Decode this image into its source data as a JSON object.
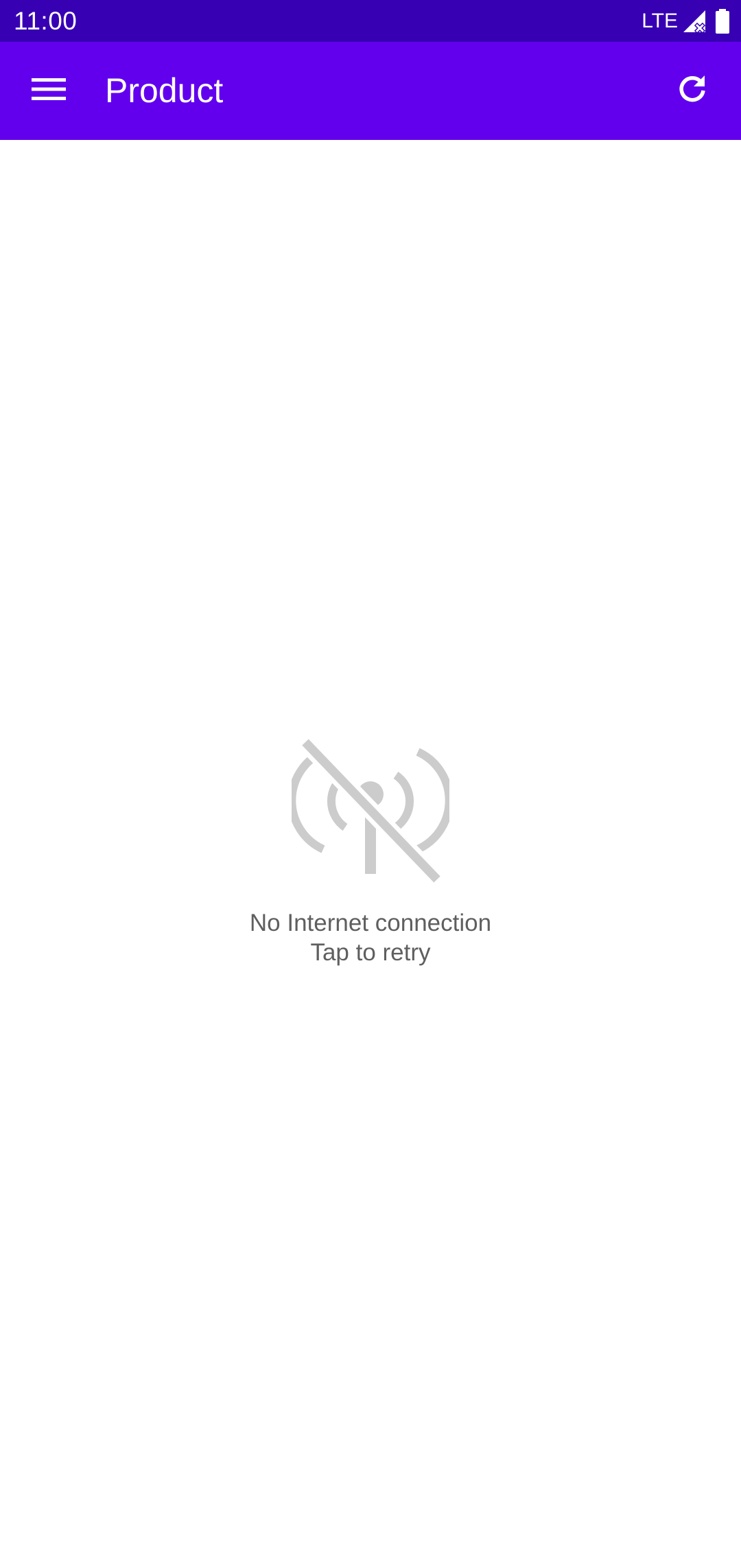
{
  "status_bar": {
    "time": "11:00",
    "network": "LTE",
    "icons": [
      "signal-no-service-icon",
      "battery-full-icon"
    ]
  },
  "app_bar": {
    "title": "Product",
    "menu_icon": "menu-icon",
    "refresh_icon": "refresh-icon"
  },
  "empty_state": {
    "icon": "no-signal-icon",
    "message": "No Internet connection",
    "action": "Tap to retry"
  },
  "colors": {
    "status_bar": "#3700b3",
    "app_bar": "#6200ee",
    "icon_gray": "#cccccc",
    "text_gray": "#5f5f5f"
  }
}
